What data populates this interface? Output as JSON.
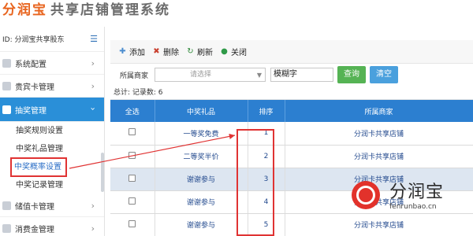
{
  "header": {
    "brand_main": "分润宝",
    "brand_sub": "共享店铺管理系统"
  },
  "sidebar": {
    "user_id": "ID: 分润宝共享股东",
    "items": [
      {
        "label": "系统配置"
      },
      {
        "label": "贵宾卡管理"
      },
      {
        "label": "抽奖管理",
        "active": true
      },
      {
        "label": "储值卡管理"
      },
      {
        "label": "消费金管理"
      }
    ],
    "subitems": [
      {
        "label": "抽奖规则设置"
      },
      {
        "label": "中奖礼品管理"
      },
      {
        "label": "中奖概率设置",
        "highlighted": true
      },
      {
        "label": "中奖记录管理"
      }
    ]
  },
  "toolbar": {
    "add_label": "添加",
    "delete_label": "删除",
    "refresh_label": "刷新",
    "close_label": "关闭"
  },
  "filter": {
    "merchant_label": "所属商家",
    "select_placeholder": "请选择",
    "keyword_value": "模糊字",
    "query_label": "查询",
    "clear_label": "清空"
  },
  "summary": {
    "text": "总计: 记录数: 6"
  },
  "table": {
    "headers": [
      "全选",
      "中奖礼品",
      "排序",
      "所属商家"
    ],
    "rows": [
      {
        "gift": "一等奖免费",
        "order": "1",
        "merchant": "分润卡共享店铺"
      },
      {
        "gift": "二等奖半价",
        "order": "2",
        "merchant": "分润卡共享店铺"
      },
      {
        "gift": "谢谢参与",
        "order": "3",
        "merchant": "分润卡共享店铺"
      },
      {
        "gift": "谢谢参与",
        "order": "4",
        "merchant": "分润卡共享店铺"
      },
      {
        "gift": "谢谢参与",
        "order": "5",
        "merchant": "分润卡共享店铺"
      }
    ]
  },
  "watermark": {
    "name": "分润宝",
    "url": "fenrunbao.cn"
  },
  "colors": {
    "primary_blue": "#2c7fd0",
    "highlight_red": "#e03333",
    "query_green": "#55b354"
  }
}
